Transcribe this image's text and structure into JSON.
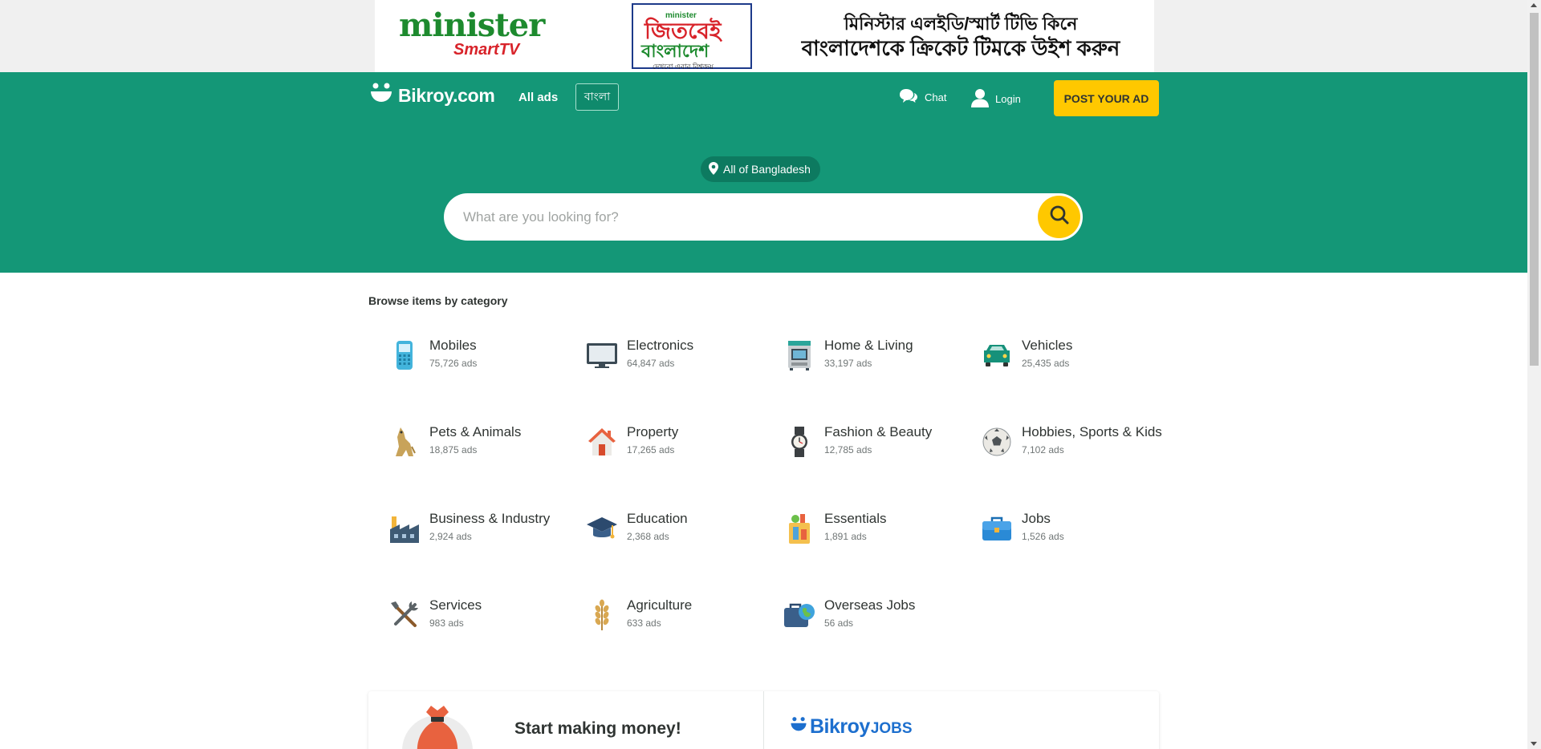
{
  "banner": {
    "brand_name": "minister",
    "brand_sub": "SmartTV",
    "badge_top": "minister",
    "badge_line1": "জিতবেই",
    "badge_line2": "বাংলাদেশ",
    "badge_line3": "দেখবো এবার বিশ্বজয়",
    "slogan_line1": "মিনিস্টার এলইডি/স্মার্ট টিভি কিনে",
    "slogan_line2": "বাংলাদেশকে ক্রিকেট টিমকে উইশ করুন"
  },
  "header": {
    "logo_text": "Bikroy.com",
    "all_ads": "All ads",
    "language": "বাংলা",
    "chat": "Chat",
    "login": "Login",
    "post_ad": "POST YOUR AD",
    "location": "All of Bangladesh",
    "search_placeholder": "What are you looking for?",
    "search_value": ""
  },
  "browse": {
    "title": "Browse items by category",
    "categories": [
      {
        "name": "Mobiles",
        "count": "75,726 ads",
        "icon": "mobile-phone-icon"
      },
      {
        "name": "Electronics",
        "count": "64,847 ads",
        "icon": "monitor-icon"
      },
      {
        "name": "Home & Living",
        "count": "33,197 ads",
        "icon": "home-appliance-icon"
      },
      {
        "name": "Vehicles",
        "count": "25,435 ads",
        "icon": "car-icon"
      },
      {
        "name": "Pets & Animals",
        "count": "18,875 ads",
        "icon": "pet-icon"
      },
      {
        "name": "Property",
        "count": "17,265 ads",
        "icon": "house-icon"
      },
      {
        "name": "Fashion & Beauty",
        "count": "12,785 ads",
        "icon": "watch-icon"
      },
      {
        "name": "Hobbies, Sports & Kids",
        "count": "7,102 ads",
        "icon": "football-icon"
      },
      {
        "name": "Business & Industry",
        "count": "2,924 ads",
        "icon": "factory-icon"
      },
      {
        "name": "Education",
        "count": "2,368 ads",
        "icon": "graduation-cap-icon"
      },
      {
        "name": "Essentials",
        "count": "1,891 ads",
        "icon": "grocery-bag-icon"
      },
      {
        "name": "Jobs",
        "count": "1,526 ads",
        "icon": "briefcase-icon"
      },
      {
        "name": "Services",
        "count": "983 ads",
        "icon": "tools-icon"
      },
      {
        "name": "Agriculture",
        "count": "633 ads",
        "icon": "wheat-icon"
      },
      {
        "name": "Overseas Jobs",
        "count": "56 ads",
        "icon": "overseas-briefcase-icon"
      }
    ]
  },
  "promo": {
    "money_title": "Start making money!",
    "jobs_brand": "Bikroy",
    "jobs_suffix": "JOBS"
  },
  "colors": {
    "header_green": "#149777",
    "accent_yellow": "#ffc800",
    "jobs_blue": "#1d6fce"
  }
}
